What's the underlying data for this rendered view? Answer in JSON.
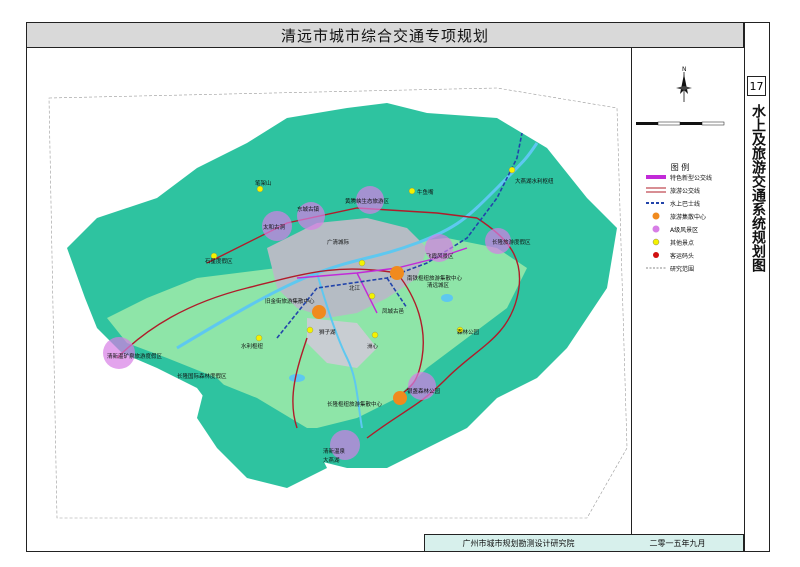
{
  "header": {
    "title": "清远市城市综合交通专项规划"
  },
  "sheet": {
    "number": "17",
    "title": "水上及旅游交通系统规划图"
  },
  "footer": {
    "institute": "广州市城市规划勘测设计研究院",
    "date": "二零一五年九月"
  },
  "legend": {
    "title": "图 例",
    "items": [
      {
        "label": "特色新型公交线",
        "icon": "magenta-line"
      },
      {
        "label": "旅游公交线",
        "icon": "red-double-line"
      },
      {
        "label": "水上巴士线",
        "icon": "blue-dashed-line"
      },
      {
        "label": "旅游集散中心",
        "icon": "orange-circle"
      },
      {
        "label": "A级风景区",
        "icon": "pink-circle"
      },
      {
        "label": "其他景点",
        "icon": "yellow-dot"
      },
      {
        "label": "客运码头",
        "icon": "red-dot"
      },
      {
        "label": "研究范围",
        "icon": "dashed-boundary"
      }
    ]
  },
  "colors": {
    "land_dark": "#2ec3a0",
    "land_light": "#8ee5a8",
    "urban": "#b5bcc4",
    "water": "#5ec8f0",
    "tour_bus": "#b01c2a",
    "special_line": "#c22ad8",
    "water_bus": "#2244aa",
    "hub": "#f08a1e",
    "scenic": "#d77ee6",
    "spot": "#f4f200"
  },
  "map_labels": {
    "hubs": [
      "南铁枢纽旅游集散中心",
      "旧金街旅游集散中心",
      "长隆枢纽旅游集散中心"
    ],
    "scenic": [
      "太和古洞",
      "飞霞风景区",
      "长隆旅游度假区",
      "清新温矿泉旅游度假区",
      "狮子湖",
      "森林公园",
      "银盏森林公园"
    ],
    "spots": [
      "笔架山",
      "东城古镇",
      "黄腾峡生态旅游区",
      "牛鱼嘴",
      "大燕湖水利枢纽",
      "石星度假区",
      "北江",
      "凤城古邑",
      "水利枢纽",
      "洲心"
    ],
    "extra": [
      "清新温泉",
      "大燕湖",
      "清远城区",
      "广清城际",
      "长隆国际森林度假区"
    ]
  }
}
